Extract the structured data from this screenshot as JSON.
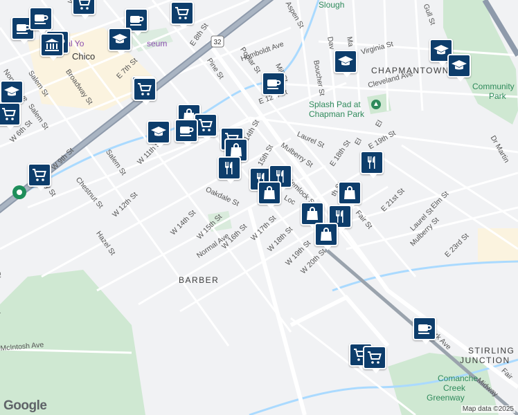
{
  "map": {
    "attribution": "Map data ©2025",
    "logo": "Google",
    "areas": [
      {
        "name": "CHAPMANTOWN"
      },
      {
        "name": "BARBER"
      },
      {
        "name": "STIRLING"
      },
      {
        "name": "JUNCTION"
      }
    ],
    "parks": [
      {
        "name": "Splash Pad at"
      },
      {
        "name": "Chapman Park"
      },
      {
        "name": "Community"
      },
      {
        "name": "Park"
      },
      {
        "name": "Comanche"
      },
      {
        "name": "Creek"
      },
      {
        "name": "Greenway"
      },
      {
        "name": "Slough"
      }
    ],
    "places": [
      {
        "name": "Chico"
      },
      {
        "name": "onal Yo"
      },
      {
        "name": "seum"
      }
    ],
    "streets": [
      "Wall St",
      "E 8th St",
      "Poplar St",
      "Humboldt Ave",
      "Pine St",
      "Mill St",
      "Boucher St",
      "Dav",
      "Ma",
      "Virginia St",
      "Cleveland Ave",
      "E 12th St",
      "Laurel St",
      "Mulberry St",
      "E 18th St",
      "E 19th St",
      "Dr Martin",
      "E 21st St",
      "Elm St",
      "Laurel St",
      "Mulberry St",
      "E 23rd St",
      "Fair St",
      "Hemlock St",
      "Oakdale St",
      "Salem St",
      "Broadway St",
      "Normal Ave",
      "Salem St",
      "W 6th St",
      "E 7th St",
      "W 11th St",
      "W 9th St",
      "Chestnut St",
      "Salem St",
      "Ivy St",
      "W 12th St",
      "Hazel St",
      "W 14th St",
      "W 15th St",
      "W 16th St",
      "Normal Ave",
      "W 17th St",
      "W 18th St",
      "W 19th St",
      "W 20th St",
      "McIntosh Ave",
      "Park Ave",
      "Midway",
      "Fair",
      "Gull St",
      "Aspen St",
      "Loc",
      "15th St",
      "14th St",
      "th St",
      "Rd",
      "ut St",
      "El",
      "El"
    ],
    "pois": [
      {
        "icon": "shopping-cart-icon"
      },
      {
        "icon": "coffee-cup-icon"
      },
      {
        "icon": "coffee-cup-icon"
      },
      {
        "icon": "coffee-cup-icon"
      },
      {
        "icon": "coffee-cup-icon"
      },
      {
        "icon": "shopping-cart-icon"
      },
      {
        "icon": "school-icon"
      },
      {
        "icon": "museum-icon"
      },
      {
        "icon": "coffee-cup-icon"
      },
      {
        "icon": "school-icon"
      },
      {
        "icon": "school-icon"
      },
      {
        "icon": "school-icon"
      },
      {
        "icon": "school-icon"
      },
      {
        "icon": "shopping-cart-icon"
      },
      {
        "icon": "shopping-cart-icon"
      },
      {
        "icon": "school-icon"
      },
      {
        "icon": "shopping-bag-icon"
      },
      {
        "icon": "shopping-cart-icon"
      },
      {
        "icon": "coffee-cup-icon"
      },
      {
        "icon": "shopping-cart-icon"
      },
      {
        "icon": "shopping-bag-icon"
      },
      {
        "icon": "restaurant-icon"
      },
      {
        "icon": "restaurant-icon"
      },
      {
        "icon": "restaurant-icon"
      },
      {
        "icon": "shopping-bag-icon"
      },
      {
        "icon": "restaurant-icon"
      },
      {
        "icon": "shopping-bag-icon"
      },
      {
        "icon": "shopping-bag-icon"
      },
      {
        "icon": "restaurant-icon"
      },
      {
        "icon": "shopping-bag-icon"
      },
      {
        "icon": "shopping-cart-icon"
      },
      {
        "icon": "coffee-cup-icon"
      },
      {
        "icon": "shopping-cart-icon"
      },
      {
        "icon": "shopping-cart-icon"
      },
      {
        "icon": "shopping-cart-icon"
      }
    ]
  }
}
